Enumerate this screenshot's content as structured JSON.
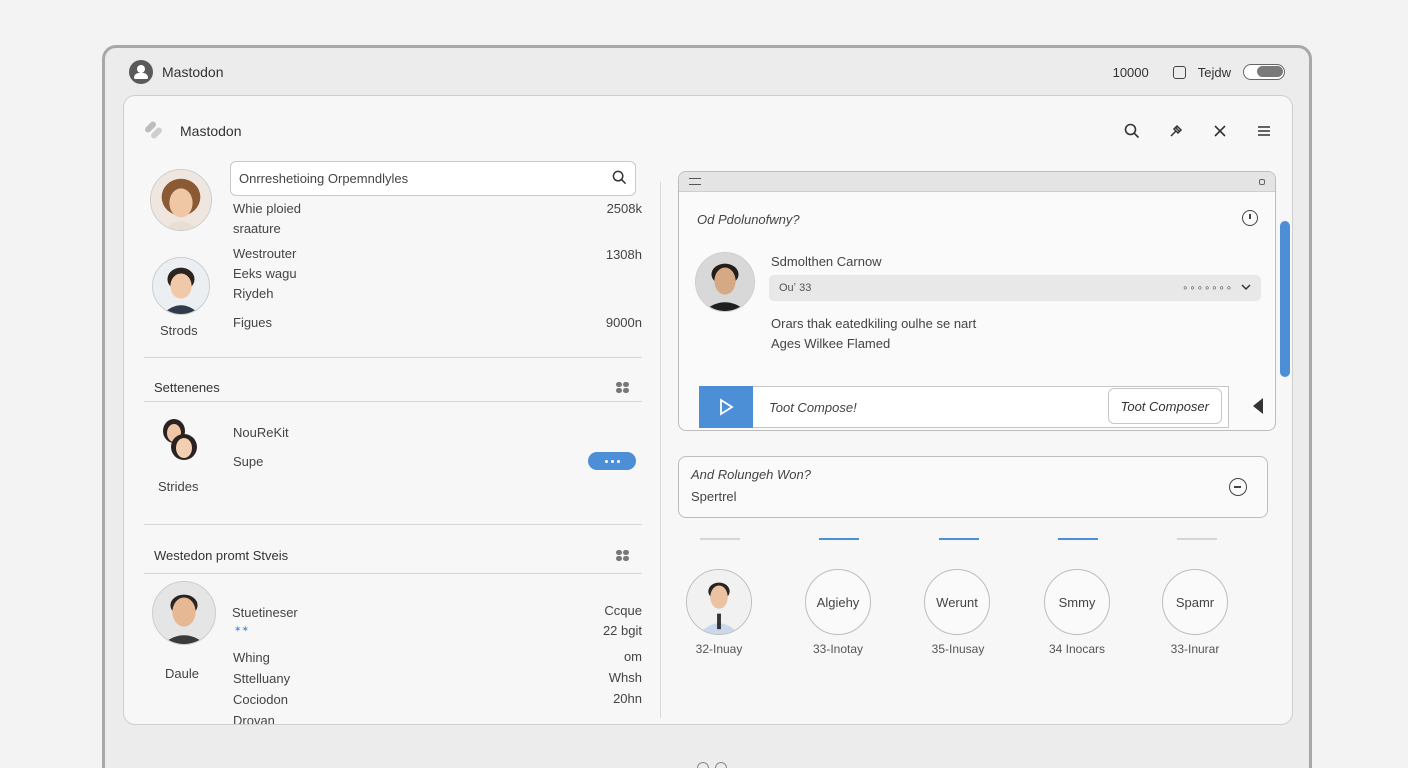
{
  "titlebar": {
    "app_title": "Mastodon",
    "count": "10000",
    "toggle_label": "Tejdw"
  },
  "window": {
    "title": "Mastodon"
  },
  "search": {
    "value": "Onrreshetioing Orpemndlyles"
  },
  "left_items": [
    {
      "name": "",
      "lines": [
        "Whie ploied",
        "sraature"
      ],
      "meta": "2508k"
    },
    {
      "name": "Strods",
      "lines": [
        "Westrouter",
        "Eeks wagu",
        "Riydeh"
      ],
      "meta": "1308h"
    },
    {
      "name": "",
      "lines": [
        "Figues"
      ],
      "meta": "9000n"
    }
  ],
  "section1": {
    "title": "Settenenes"
  },
  "suggestion": {
    "name": "Strides",
    "line1": "NouReKit",
    "line2": "Supe"
  },
  "section2": {
    "title": "Westedon promt Stveis"
  },
  "bottom_item": {
    "name": "Daule",
    "lines": [
      "Stuetineser",
      "Whing",
      "Sttelluany",
      "Cociodon",
      "Drovan"
    ],
    "sub": "✶✶",
    "meta": [
      "Ccque",
      "22 bgit",
      "om",
      "Whsh",
      "20hn"
    ]
  },
  "toot": {
    "question": "Od Pdolunofwny?",
    "author": "Sdmolthen Carnow",
    "dropdown_label": "Ouʼ 33",
    "dropdown_dots": "∘∘∘∘∘∘∘",
    "body_line1": "Orars thak eatedkiling oulhe se nart",
    "body_line2": "Ages Wilkee Flamed",
    "composer_placeholder": "Toot Compose!",
    "composer_button": "Toot Composer"
  },
  "question_card": {
    "title": "And Rolungeh Won?",
    "sub": "Spertrel"
  },
  "people": [
    {
      "label": "",
      "sub": "32-Inuay"
    },
    {
      "label": "Algiehy",
      "sub": "33-Inotay"
    },
    {
      "label": "Werunt",
      "sub": "35-Inusay"
    },
    {
      "label": "Smmy",
      "sub": "34 Inocars"
    },
    {
      "label": "Spamr",
      "sub": "33-Inurar"
    }
  ],
  "colors": {
    "accent": "#4d8fd6",
    "border": "#bdbdbd",
    "background": "#f7f7f7"
  }
}
